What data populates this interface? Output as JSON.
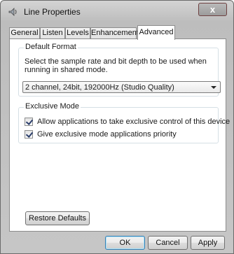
{
  "window": {
    "title": "Line Properties",
    "close_label": "x",
    "icon": "speaker-icon"
  },
  "tabs": [
    {
      "label": "General"
    },
    {
      "label": "Listen"
    },
    {
      "label": "Levels"
    },
    {
      "label": "Enhancements"
    },
    {
      "label": "Advanced"
    }
  ],
  "default_format": {
    "title": "Default Format",
    "description": "Select the sample rate and bit depth to be used when running in shared mode.",
    "selected": "2 channel, 24bit, 192000Hz (Studio Quality)"
  },
  "exclusive_mode": {
    "title": "Exclusive Mode",
    "options": [
      {
        "label": "Allow applications to take exclusive control of this device",
        "checked": true
      },
      {
        "label": "Give exclusive mode applications priority",
        "checked": true
      }
    ]
  },
  "buttons": {
    "restore_defaults": "Restore Defaults",
    "ok": "OK",
    "cancel": "Cancel",
    "apply": "Apply"
  }
}
